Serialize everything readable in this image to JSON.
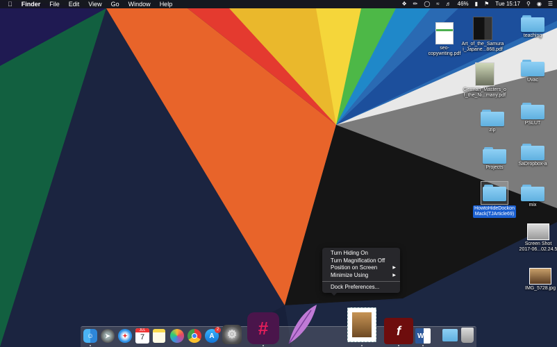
{
  "menubar": {
    "apple_icon": "apple-icon",
    "app_name": "Finder",
    "menus": [
      "File",
      "Edit",
      "View",
      "Go",
      "Window",
      "Help"
    ],
    "battery": "46%",
    "clock": "Tue 15:17"
  },
  "desktop": {
    "items": [
      {
        "label": "seo-\ncopywriting.pdf"
      },
      {
        "label": "Art_of_the_Samura\ni_Japane...868.pdf"
      },
      {
        "label": "teaching"
      },
      {
        "label": "German_Masters_o\nf_the_Ni...many.pdf"
      },
      {
        "label": "Uvac"
      },
      {
        "label": "zip"
      },
      {
        "label": "PSLUT"
      },
      {
        "label": "Projects"
      },
      {
        "label": "SaDropbox-a"
      },
      {
        "label": "HowtoHideDockon\nMack(TJArticle69)"
      },
      {
        "label": "mix"
      },
      {
        "label": "Screen Shot\n2017-06...02.24.5"
      },
      {
        "label": "IMG_5728.jpg"
      }
    ]
  },
  "context_menu": {
    "items": [
      {
        "label": "Turn Hiding On",
        "submenu": false
      },
      {
        "label": "Turn Magnification Off",
        "submenu": false
      },
      {
        "label": "Position on Screen",
        "submenu": true
      },
      {
        "label": "Minimize Using",
        "submenu": true
      }
    ],
    "preferences": "Dock Preferences...",
    "submenu_arrow": "▶"
  },
  "dock": {
    "calendar_month": "JUL",
    "calendar_day": "7",
    "appstore_badge": "2",
    "apps": [
      "finder-icon",
      "launchpad-icon",
      "safari-icon",
      "calendar-icon",
      "notes-icon",
      "photos-icon",
      "chrome-icon",
      "app-store-icon",
      "system-preferences-icon",
      "slack-icon",
      "quill-icon",
      "mail-icon",
      "flash-icon",
      "word-icon",
      "downloads-folder-icon",
      "trash-icon"
    ]
  },
  "colors": {
    "selection": "#1a5fd0",
    "folder": "#6cc0ee"
  }
}
